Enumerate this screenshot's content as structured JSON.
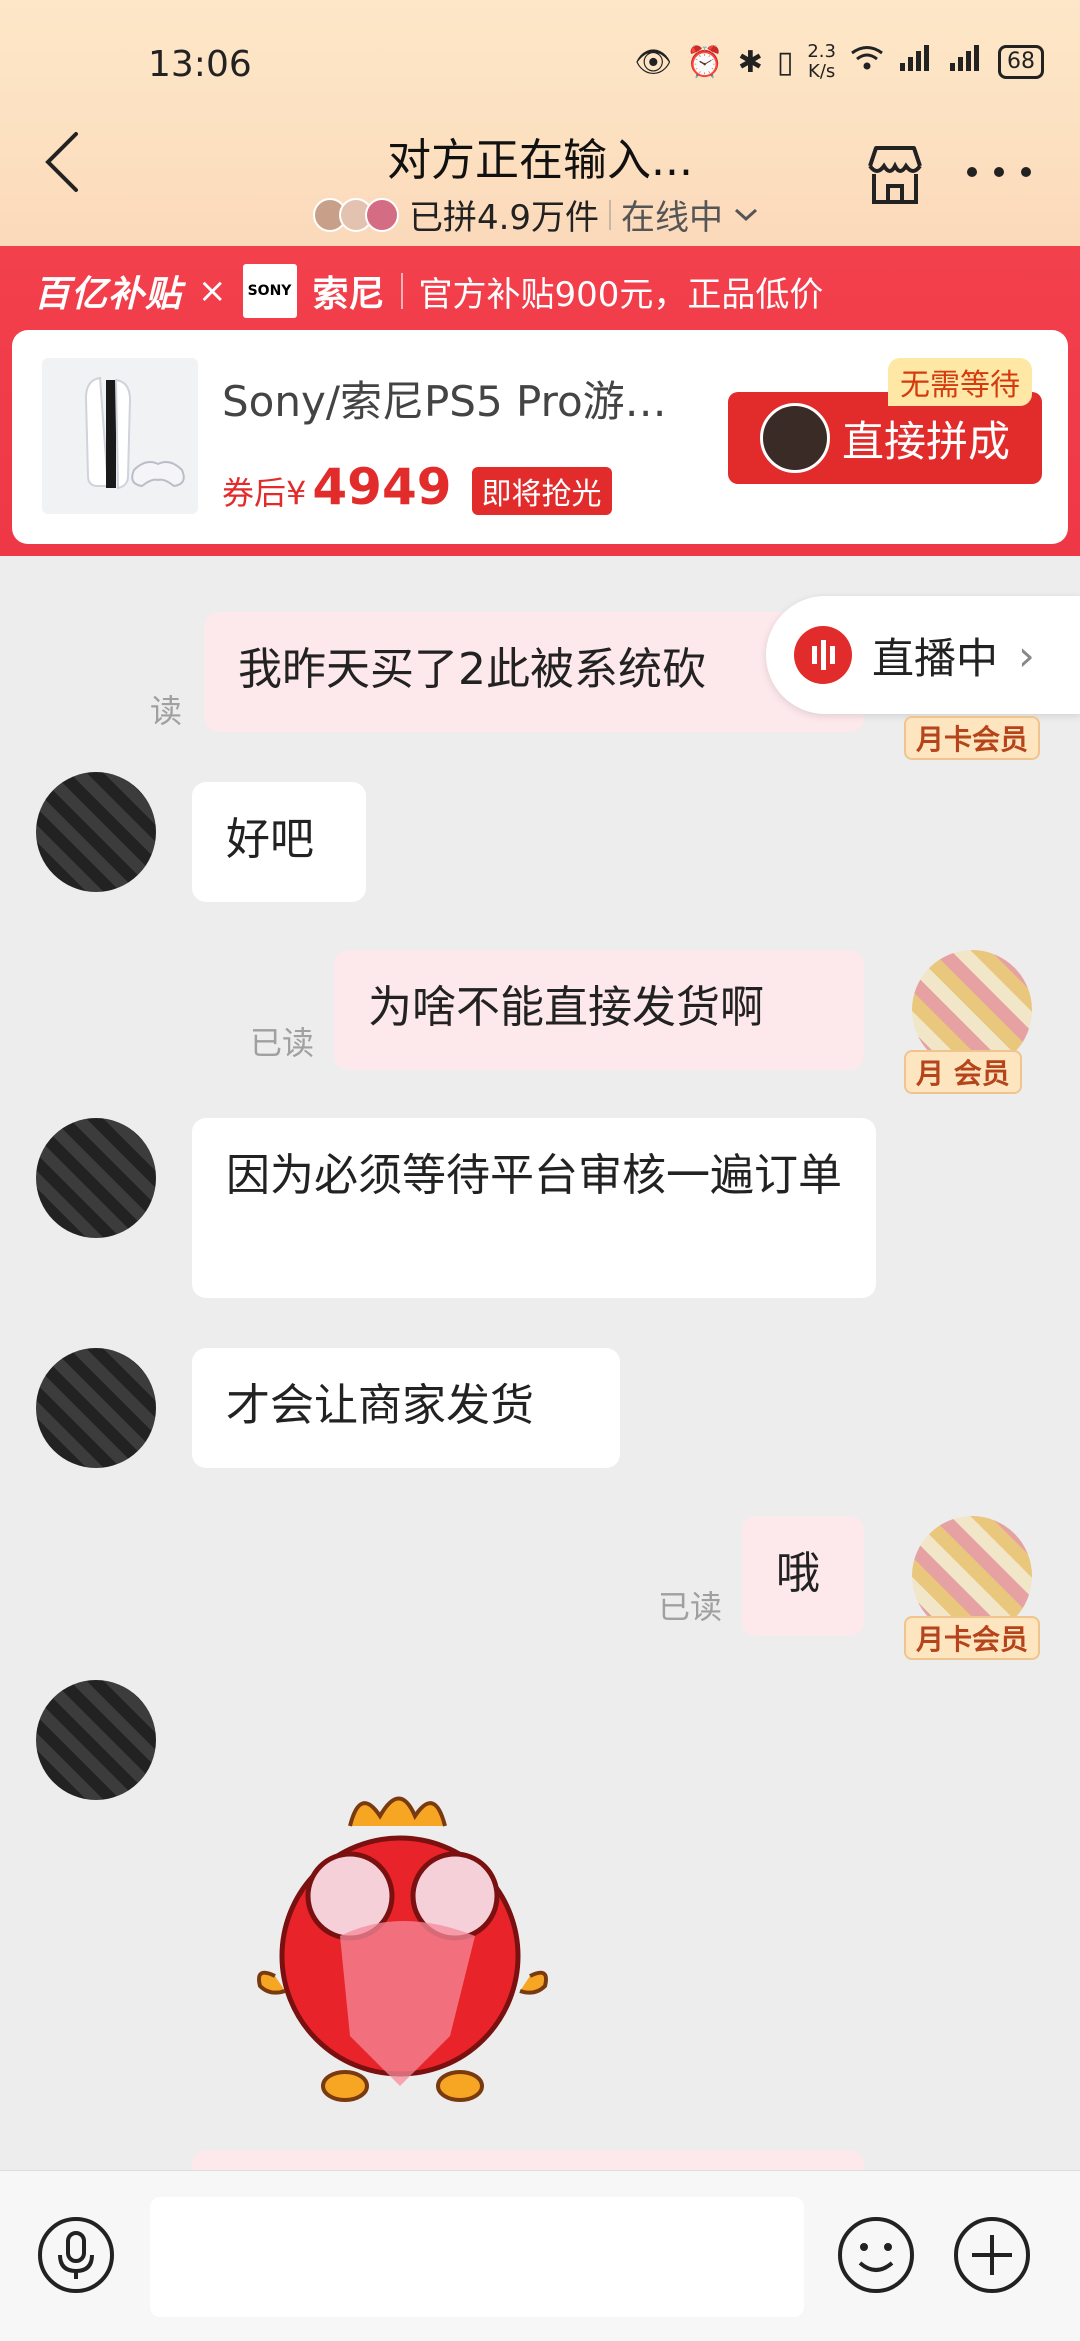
{
  "status_bar": {
    "time": "13:06",
    "net_speed_value": "2.3",
    "net_speed_unit": "K/s",
    "battery": "68"
  },
  "header": {
    "title": "对方正在输入...",
    "group_count": "已拼4.9万件",
    "online_status": "在线中"
  },
  "banner": {
    "program": "百亿补贴",
    "times": "×",
    "brand_logo": "SONY",
    "brand_name": "索尼",
    "promo": "官方补贴900元，正品低价"
  },
  "product": {
    "name": "Sony/索尼PS5 Pro游…",
    "price_prefix": "券后¥",
    "price": "4949",
    "urgency_tag": "即将抢光",
    "no_wait_tag": "无需等待",
    "buy_button": "直接拼成"
  },
  "live": {
    "label": "直播中",
    "arrow": "›"
  },
  "vip_badge": "月卡会员",
  "messages": [
    {
      "side": "mine",
      "text": "我昨天买了2此被系统砍",
      "read": "已读"
    },
    {
      "side": "theirs",
      "text": "好吧"
    },
    {
      "side": "mine",
      "text": "为啥不能直接发货啊",
      "read": "已读"
    },
    {
      "side": "theirs",
      "text": "因为必须等待平台审核一遍订单"
    },
    {
      "side": "theirs",
      "text": "才会让商家发货"
    },
    {
      "side": "mine",
      "text": "哦",
      "read": "已读"
    }
  ],
  "partial_read": "读",
  "partial_vip": "月 会员",
  "input": {
    "placeholder": ""
  }
}
